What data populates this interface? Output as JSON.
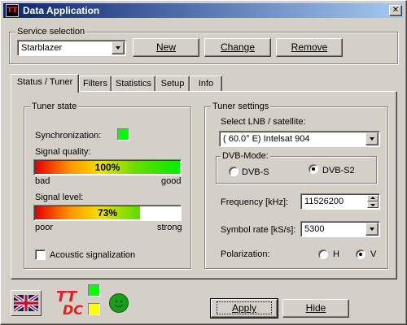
{
  "window": {
    "title": "Data Application",
    "close_glyph": "✕",
    "app_icon": "tt-dc-app-icon",
    "app_icon_text": "TT"
  },
  "service": {
    "group_label": "Service selection",
    "selected": "Starblazer",
    "new_label": "New",
    "change_label": "Change",
    "remove_label": "Remove"
  },
  "tabs": [
    {
      "label": "Status / Tuner",
      "active": true
    },
    {
      "label": "Filters"
    },
    {
      "label": "Statistics"
    },
    {
      "label": "Setup"
    },
    {
      "label": "Info"
    }
  ],
  "tuner_state": {
    "group_label": "Tuner state",
    "sync_label": "Synchronization:",
    "sync_color": "#00ff00",
    "quality_label": "Signal quality:",
    "quality_value": 100,
    "quality_text": "100%",
    "quality_min": "bad",
    "quality_max": "good",
    "level_label": "Signal level:",
    "level_value": 73,
    "level_text": "73%",
    "level_min": "poor",
    "level_max": "strong",
    "acoustic_label": "Acoustic signalization",
    "acoustic_checked": false
  },
  "tuner_settings": {
    "group_label": "Tuner settings",
    "lnb_label": "Select LNB / satellite:",
    "lnb_value": "( 60.0° E) Intelsat 904",
    "dvb_group_label": "DVB-Mode:",
    "dvb_s_label": "DVB-S",
    "dvb_s2_label": "DVB-S2",
    "dvb_selected": "DVB-S2",
    "frequency_label": "Frequency [kHz]:",
    "frequency_value": "11526200",
    "symbol_rate_label": "Symbol rate [kS/s]:",
    "symbol_rate_value": "5300",
    "polarization_label": "Polarization:",
    "pol_h_label": "H",
    "pol_v_label": "V",
    "pol_selected": "V"
  },
  "footer": {
    "flag_icon": "uk-flag-icon",
    "logo_text_top": "TT",
    "logo_text_bottom": "DC",
    "indicator_top_color": "#00ff00",
    "indicator_bottom_color": "#ffff00",
    "smiley_color": "#1a9e1a",
    "apply_label": "Apply",
    "hide_label": "Hide"
  }
}
